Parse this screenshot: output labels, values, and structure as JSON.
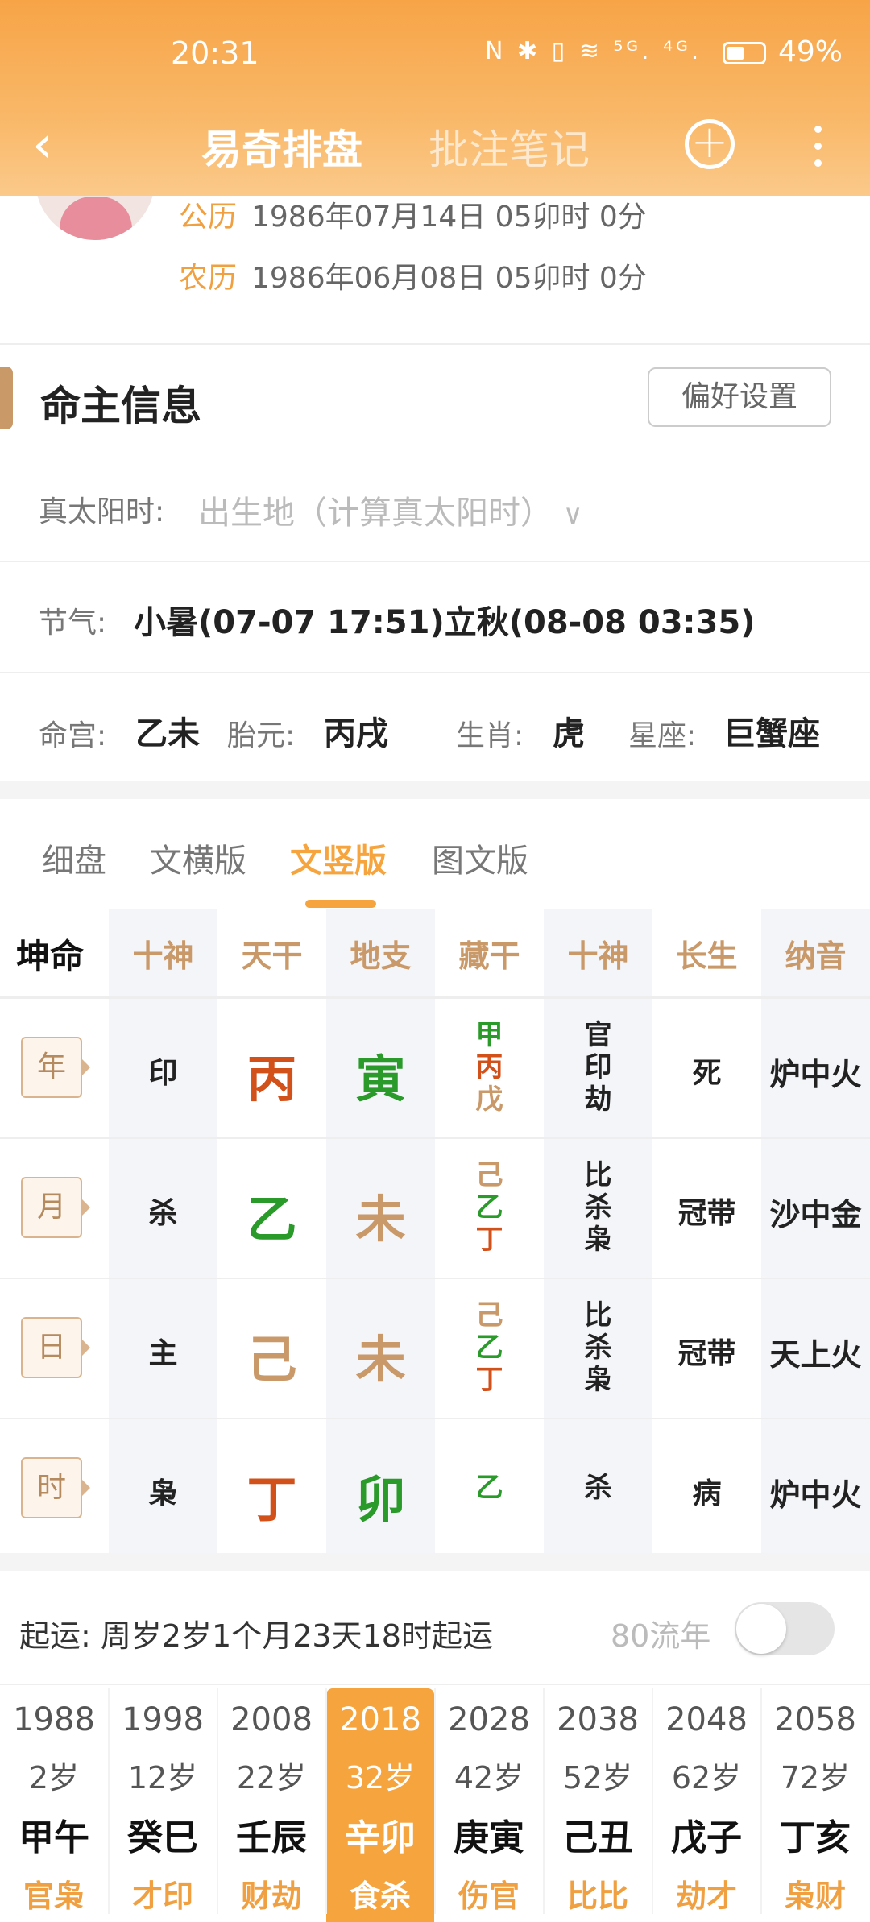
{
  "status_bar": {
    "time": "20:31",
    "icons": "N ✱ ▯ ≋ ⁵ᴳ. ⁴ᴳ.",
    "battery": "49%"
  },
  "nav": {
    "title": "易奇排盘",
    "tab2": "批注笔记"
  },
  "profile": {
    "solar_label": "公历",
    "solar_value": "1986年07月14日 05卯时 0分",
    "lunar_label": "农历",
    "lunar_value": "1986年06月08日 05卯时 0分"
  },
  "info": {
    "title": "命主信息",
    "pref_button": "偏好设置",
    "solar_time_label": "真太阳时:",
    "solar_time_placeholder": "出生地（计算真太阳时）",
    "jieqi_label": "节气:",
    "jieqi_value": "小暑(07-07 17:51)立秋(08-08 03:35)",
    "minggong_label": "命宫:",
    "minggong_value": "乙未",
    "taiyuan_label": "胎元:",
    "taiyuan_value": "丙戌",
    "shengxiao_label": "生肖:",
    "shengxiao_value": "虎",
    "xingzuo_label": "星座:",
    "xingzuo_value": "巨蟹座"
  },
  "view_tabs": [
    "细盘",
    "文横版",
    "文竖版",
    "图文版"
  ],
  "active_tab": "文竖版",
  "chart": {
    "corner": "坤命",
    "headers": [
      "十神",
      "天干",
      "地支",
      "藏干",
      "十神",
      "长生",
      "纳音"
    ],
    "rows": [
      {
        "label": "年",
        "shishen": "印",
        "tiangan": "丙",
        "tg_color": "#d2501a",
        "dizhi": "寅",
        "dz_color": "#2a9a2a",
        "canggan": [
          {
            "c": "甲",
            "col": "#2a9a2a"
          },
          {
            "c": "丙",
            "col": "#d2501a"
          },
          {
            "c": "戊",
            "col": "#c9996a"
          }
        ],
        "shishen2": [
          "官",
          "印",
          "劫"
        ],
        "changsheng": "死",
        "nayin": "炉中火"
      },
      {
        "label": "月",
        "shishen": "杀",
        "tiangan": "乙",
        "tg_color": "#2a9a2a",
        "dizhi": "未",
        "dz_color": "#c9996a",
        "canggan": [
          {
            "c": "己",
            "col": "#c9996a"
          },
          {
            "c": "乙",
            "col": "#2a9a2a"
          },
          {
            "c": "丁",
            "col": "#d2501a"
          }
        ],
        "shishen2": [
          "比",
          "杀",
          "枭"
        ],
        "changsheng": "冠带",
        "nayin": "沙中金"
      },
      {
        "label": "日",
        "shishen": "主",
        "tiangan": "己",
        "tg_color": "#c9996a",
        "dizhi": "未",
        "dz_color": "#c9996a",
        "canggan": [
          {
            "c": "己",
            "col": "#c9996a"
          },
          {
            "c": "乙",
            "col": "#2a9a2a"
          },
          {
            "c": "丁",
            "col": "#d2501a"
          }
        ],
        "shishen2": [
          "比",
          "杀",
          "枭"
        ],
        "changsheng": "冠带",
        "nayin": "天上火"
      },
      {
        "label": "时",
        "shishen": "枭",
        "tiangan": "丁",
        "tg_color": "#d2501a",
        "dizhi": "卯",
        "dz_color": "#2a9a2a",
        "canggan": [
          {
            "c": "乙",
            "col": "#2a9a2a"
          }
        ],
        "shishen2": [
          "杀"
        ],
        "changsheng": "病",
        "nayin": "炉中火"
      }
    ]
  },
  "qiyun": {
    "text": "起运:  周岁2岁1个月23天18时起运",
    "liunian_label": "80流年",
    "liunian_on": false
  },
  "dayun": [
    {
      "year": "1988",
      "age": "2岁",
      "ganzhi": "甲午",
      "shishen": "官枭"
    },
    {
      "year": "1998",
      "age": "12岁",
      "ganzhi": "癸巳",
      "shishen": "才印"
    },
    {
      "year": "2008",
      "age": "22岁",
      "ganzhi": "壬辰",
      "shishen": "财劫"
    },
    {
      "year": "2018",
      "age": "32岁",
      "ganzhi": "辛卯",
      "shishen": "食杀"
    },
    {
      "year": "2028",
      "age": "42岁",
      "ganzhi": "庚寅",
      "shishen": "伤官"
    },
    {
      "year": "2038",
      "age": "52岁",
      "ganzhi": "己丑",
      "shishen": "比比"
    },
    {
      "year": "2048",
      "age": "62岁",
      "ganzhi": "戊子",
      "shishen": "劫才"
    },
    {
      "year": "2058",
      "age": "72岁",
      "ganzhi": "丁亥",
      "shishen": "枭财"
    }
  ],
  "dayun_selected": "2018"
}
